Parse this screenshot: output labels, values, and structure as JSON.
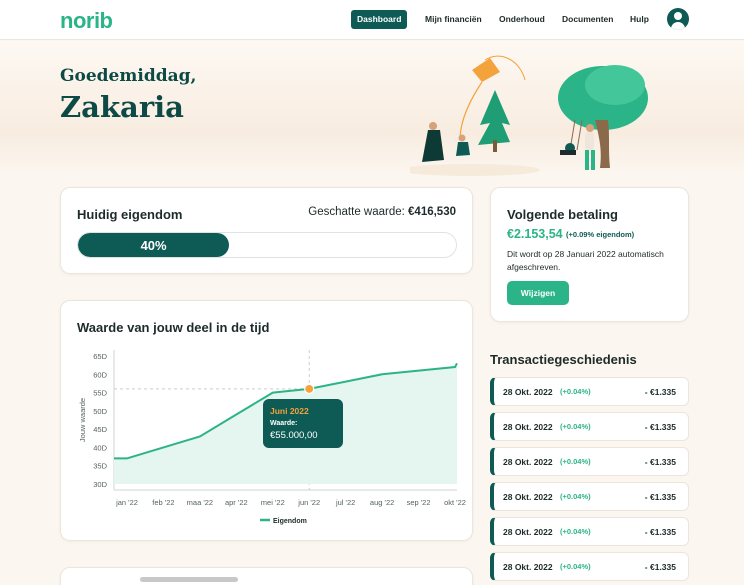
{
  "nav": {
    "logo": "norib",
    "links": [
      "Dashboard",
      "Mijn financiën",
      "Onderhoud",
      "Documenten",
      "Hulp"
    ]
  },
  "hero": {
    "greeting": "Goedemiddag,",
    "name": "Zakaria"
  },
  "ownership": {
    "title": "Huidig eigendom",
    "estimate_label": "Geschatte waarde:",
    "estimate_value": "€416,530",
    "progress_label": "40%",
    "progress_fraction": 0.4
  },
  "payment": {
    "title": "Volgende betaling",
    "amount": "€2.153,54",
    "pct": "(+0.09% eigendom)",
    "description": "Dit wordt op 28 Januari 2022 automatisch afgeschreven.",
    "button": "Wijzigen"
  },
  "chart_card": {
    "title": "Waarde van jouw deel in de tijd"
  },
  "chart_data": {
    "type": "area",
    "title": "Waarde van jouw deel in de tijd",
    "ylabel": "Jouw waarde",
    "categories": [
      "jan '22",
      "feb '22",
      "maa '22",
      "apr '22",
      "mei '22",
      "jun '22",
      "jul '22",
      "aug '22",
      "sep '22",
      "okt '22"
    ],
    "series": [
      {
        "name": "Eigendom",
        "values": [
          37,
          40,
          43,
          49,
          55,
          56,
          58,
          60,
          61,
          62
        ],
        "end_value": 63
      }
    ],
    "yticks": [
      "30D",
      "35D",
      "40D",
      "45D",
      "50D",
      "55D",
      "60D",
      "65D"
    ],
    "ylim": [
      30,
      65
    ],
    "reference_line": 56,
    "highlight": {
      "index": 5,
      "label": "Juni 2022",
      "value_label": "Waarde:",
      "value": "€55.000,00"
    },
    "legend_position": "bottom",
    "grid": false,
    "color": "#2bb487"
  },
  "transactions": {
    "title": "Transactiegeschiedenis",
    "rows": [
      {
        "date": "28 Okt. 2022",
        "pct": "(+0.04%)",
        "amount": "- €1.335"
      },
      {
        "date": "28 Okt. 2022",
        "pct": "(+0.04%)",
        "amount": "- €1.335"
      },
      {
        "date": "28 Okt. 2022",
        "pct": "(+0.04%)",
        "amount": "- €1.335"
      },
      {
        "date": "28 Okt. 2022",
        "pct": "(+0.04%)",
        "amount": "- €1.335"
      },
      {
        "date": "28 Okt. 2022",
        "pct": "(+0.04%)",
        "amount": "- €1.335"
      },
      {
        "date": "28 Okt. 2022",
        "pct": "(+0.04%)",
        "amount": "- €1.335"
      }
    ]
  },
  "icons": {
    "avatar": "user-avatar-icon"
  },
  "colors": {
    "primary": "#0e5a55",
    "accent": "#2bb487",
    "highlight": "#f4a23c"
  }
}
